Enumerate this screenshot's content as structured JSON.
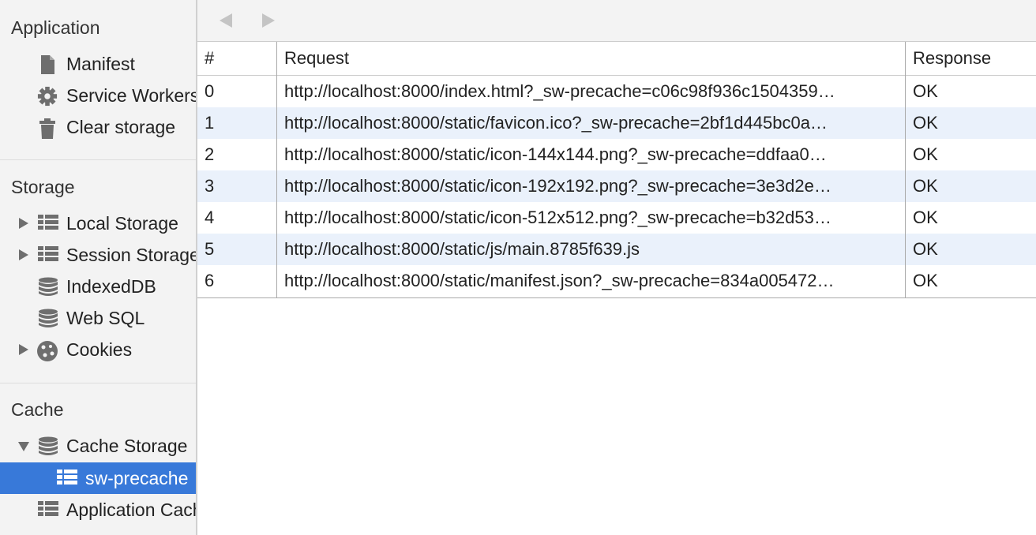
{
  "sidebar": {
    "sections": {
      "application": {
        "title": "Application",
        "items": {
          "manifest": {
            "label": "Manifest",
            "icon": "document-icon"
          },
          "service_workers": {
            "label": "Service Workers",
            "icon": "gear-icon"
          },
          "clear_storage": {
            "label": "Clear storage",
            "icon": "trash-icon"
          }
        }
      },
      "storage": {
        "title": "Storage",
        "items": {
          "local_storage": {
            "label": "Local Storage",
            "icon": "grid-icon",
            "expanded": false
          },
          "session_storage": {
            "label": "Session Storage",
            "icon": "grid-icon",
            "expanded": false
          },
          "indexeddb": {
            "label": "IndexedDB",
            "icon": "database-icon"
          },
          "web_sql": {
            "label": "Web SQL",
            "icon": "database-icon"
          },
          "cookies": {
            "label": "Cookies",
            "icon": "cookie-icon",
            "expanded": false
          }
        }
      },
      "cache": {
        "title": "Cache",
        "items": {
          "cache_storage": {
            "label": "Cache Storage",
            "icon": "database-icon",
            "expanded": true
          },
          "sw_precache": {
            "label": "sw-precache",
            "icon": "grid-icon",
            "selected": true
          },
          "application_cache": {
            "label": "Application Cache",
            "icon": "grid-icon"
          }
        }
      }
    }
  },
  "toolbar": {
    "back_icon": "triangle-left-icon",
    "forward_icon": "triangle-right-icon"
  },
  "table": {
    "headers": {
      "index": "#",
      "request": "Request",
      "response": "Response"
    },
    "rows": [
      {
        "index": "0",
        "request": "http://localhost:8000/index.html?_sw-precache=c06c98f936c1504359…",
        "response": "OK"
      },
      {
        "index": "1",
        "request": "http://localhost:8000/static/favicon.ico?_sw-precache=2bf1d445bc0a…",
        "response": "OK"
      },
      {
        "index": "2",
        "request": "http://localhost:8000/static/icon-144x144.png?_sw-precache=ddfaa0…",
        "response": "OK"
      },
      {
        "index": "3",
        "request": "http://localhost:8000/static/icon-192x192.png?_sw-precache=3e3d2e…",
        "response": "OK"
      },
      {
        "index": "4",
        "request": "http://localhost:8000/static/icon-512x512.png?_sw-precache=b32d53…",
        "response": "OK"
      },
      {
        "index": "5",
        "request": "http://localhost:8000/static/js/main.8785f639.js",
        "response": "OK"
      },
      {
        "index": "6",
        "request": "http://localhost:8000/static/manifest.json?_sw-precache=834a005472…",
        "response": "OK"
      }
    ]
  },
  "colors": {
    "selection": "#3879d9",
    "alt_row": "#eaf1fb",
    "sidebar_bg": "#f3f3f3"
  }
}
